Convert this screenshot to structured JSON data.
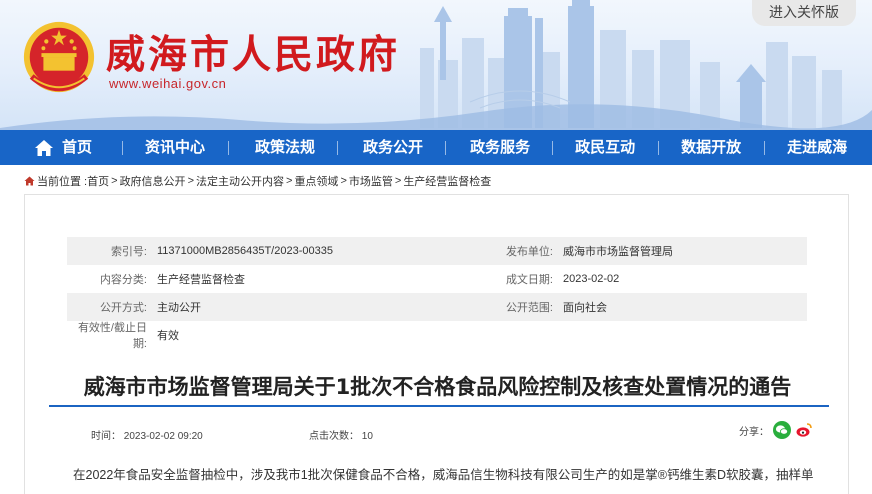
{
  "header": {
    "site_title": "威海市人民政府",
    "site_url": "www.weihai.gov.cn",
    "care_mode_label": "进入关怀版"
  },
  "nav": {
    "items": [
      {
        "label": "首页",
        "icon": "home-icon"
      },
      {
        "label": "资讯中心"
      },
      {
        "label": "政策法规"
      },
      {
        "label": "政务公开"
      },
      {
        "label": "政务服务"
      },
      {
        "label": "政民互动"
      },
      {
        "label": "数据开放"
      },
      {
        "label": "走进威海"
      }
    ]
  },
  "breadcrumb": {
    "prefix": "当前位置 :",
    "items": [
      "首页",
      "政府信息公开",
      "法定主动公开内容",
      "重点领域",
      "市场监管",
      "生产经营监督检查"
    ]
  },
  "meta": {
    "index_label": "索引号:",
    "index_value": "11371000MB2856435T/2023-00335",
    "publisher_label": "发布单位:",
    "publisher_value": "威海市市场监督管理局",
    "category_label": "内容分类:",
    "category_value": "生产经营监督检查",
    "created_label": "成文日期:",
    "created_value": "2023-02-02",
    "mode_label": "公开方式:",
    "mode_value": "主动公开",
    "scope_label": "公开范围:",
    "scope_value": "面向社会",
    "validity_label": "有效性/截止日期:",
    "validity_value": "有效"
  },
  "article": {
    "title": "威海市市场监督管理局关于1批次不合格食品风险控制及核查处置情况的通告",
    "time_label": "时间：",
    "time_value": "2023-02-02 09:20",
    "views_label": "点击次数：",
    "views_value": "10",
    "share_label": "分享：",
    "body_first_line": "在2022年食品安全监督抽检中，涉及我市1批次保健食品不合格，威海品信生物科技有限公司生产的如是掌®钙维生素D软胶囊，抽样单"
  },
  "colors": {
    "nav_bg": "#1865c7",
    "title_red": "#d11a1e",
    "rule_blue": "#1b64c2"
  }
}
